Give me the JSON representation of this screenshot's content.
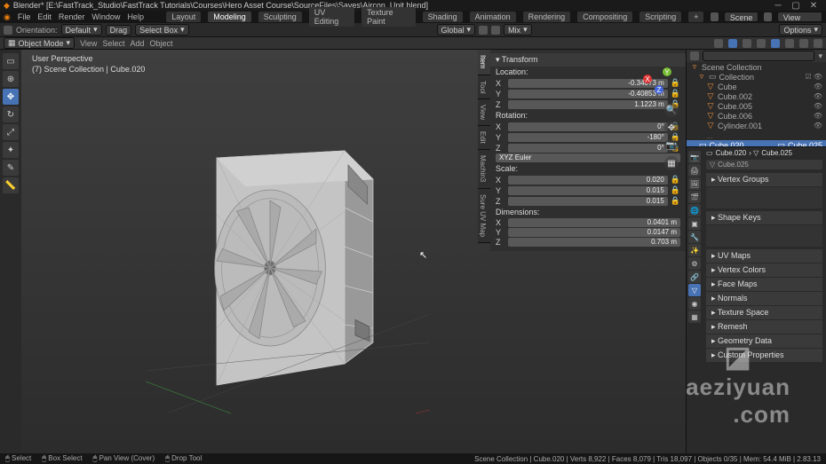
{
  "title": "Blender* [E:\\FastTrack_Studio\\FastTrack Tutorials\\Courses\\Hero Asset Course\\SourceFiles\\Saves\\Aircon_Unit.blend]",
  "menubar": [
    "File",
    "Edit",
    "Render",
    "Window",
    "Help"
  ],
  "workspaces": [
    "Layout",
    "Modeling",
    "Sculpting",
    "UV Editing",
    "Texture Paint",
    "Shading",
    "Animation",
    "Rendering",
    "Compositing",
    "Scripting",
    "+"
  ],
  "workspace_active": "Modeling",
  "scene_label": "Scene",
  "viewlayer_label": "View Layer",
  "top2": {
    "orientation": "Orientation:",
    "pivot": "Default",
    "snap": "Drag",
    "select_mode": "Select Box",
    "transform_space": "Global",
    "overlay": "Mix",
    "options": "Options"
  },
  "secondary": {
    "mode": "Object Mode",
    "menus": [
      "View",
      "Select",
      "Add",
      "Object"
    ]
  },
  "viewport": {
    "persp": "User Perspective",
    "collection": "(7) Scene Collection | Cube.020"
  },
  "npanel_tabs": [
    "Item",
    "Tool",
    "View",
    "Edit",
    "Machin3",
    "Sure UV Map"
  ],
  "npanel_active": "Item",
  "transform": {
    "header": "Transform",
    "location_label": "Location:",
    "loc": {
      "x": "-0.34073 m",
      "y": "-0.40853 m",
      "z": "1.1223 m"
    },
    "rotation_label": "Rotation:",
    "rot": {
      "x": "0°",
      "y": "-180°",
      "z": "0°"
    },
    "mode": "XYZ Euler",
    "scale_label": "Scale:",
    "scale": {
      "x": "0.020",
      "y": "0.015",
      "z": "0.015"
    },
    "dim_label": "Dimensions:",
    "dim": {
      "x": "0.0401 m",
      "y": "0.0147 m",
      "z": "0.703 m"
    }
  },
  "outliner": {
    "root": "Scene Collection",
    "collection": "Collection",
    "items": [
      "Cube",
      "Cube.002",
      "Cube.005",
      "Cube.006",
      "Cylinder.001",
      "..."
    ],
    "selected": "Cube.020",
    "sibling": "Cube.025"
  },
  "props": {
    "bcrumb": "Cube.025",
    "sections": [
      "Vertex Groups",
      "Shape Keys",
      "UV Maps",
      "Vertex Colors",
      "Face Maps",
      "Normals",
      "Texture Space",
      "Remesh",
      "Geometry Data",
      "Custom Properties"
    ]
  },
  "statusbar": {
    "left": [
      "Select",
      "Box Select",
      "Pan View (Cover)",
      "Drop Tool"
    ],
    "right": "Scene Collection | Cube.020 | Verts 8,922 | Faces 8,079 | Tris 18,097 | Objects 0/35 | Mem: 54.4 MiB | 2.83.13"
  },
  "watermark": {
    "l1": "aeziyuan",
    "l2": ".com"
  }
}
